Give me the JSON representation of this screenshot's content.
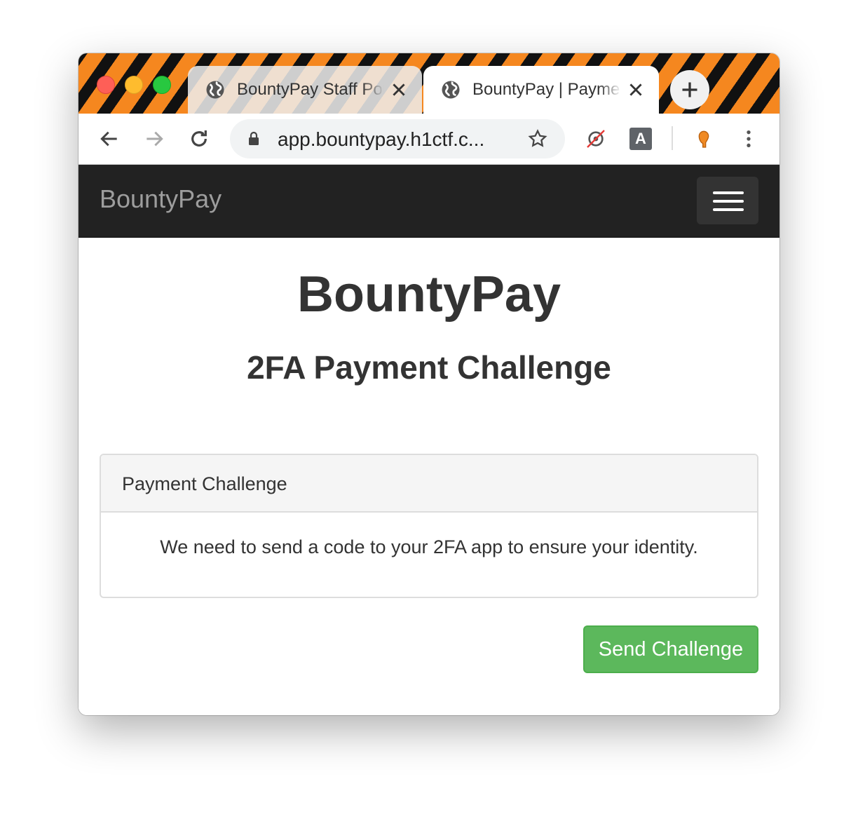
{
  "browser": {
    "tabs": [
      {
        "title": "BountyPay Staff Portal",
        "active": false
      },
      {
        "title": "BountyPay | Payment",
        "active": true
      }
    ],
    "url": "app.bountypay.h1ctf.c...",
    "extension_letter": "A"
  },
  "navbar": {
    "brand": "BountyPay"
  },
  "page": {
    "title": "BountyPay",
    "subtitle": "2FA Payment Challenge",
    "panel": {
      "heading": "Payment Challenge",
      "body": "We need to send a code to your 2FA app to ensure your identity."
    },
    "button_label": "Send Challenge"
  },
  "colors": {
    "navbar_bg": "#222222",
    "button_success": "#5cb85c",
    "titlebar_stripe_orange": "#f5871f",
    "titlebar_stripe_black": "#111111"
  }
}
